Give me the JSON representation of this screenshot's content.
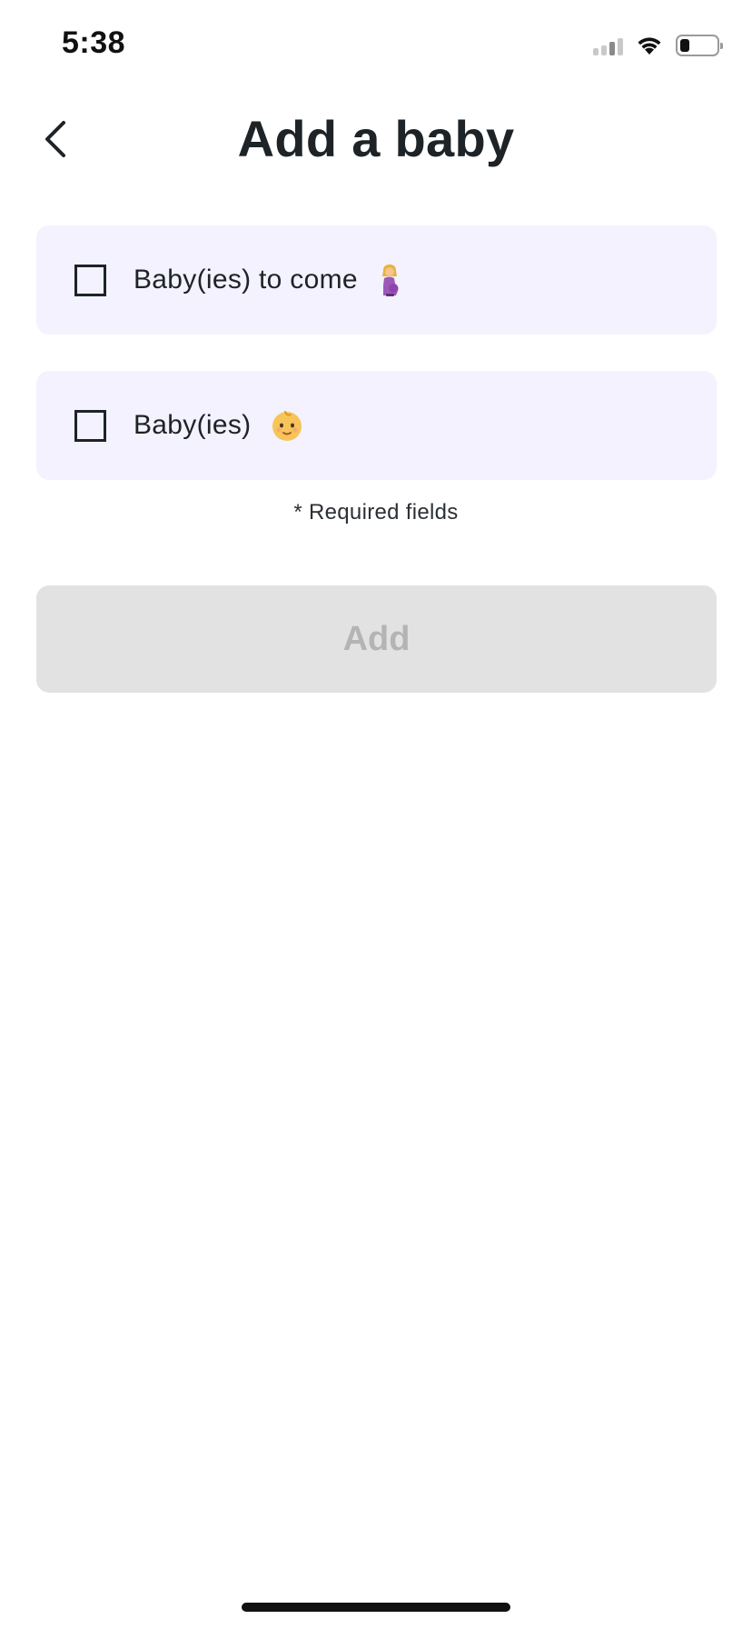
{
  "status_bar": {
    "time": "5:38",
    "icons": [
      "cellular-signal-icon",
      "wifi-icon",
      "battery-icon"
    ]
  },
  "header": {
    "back_icon": "chevron-left-icon",
    "title": "Add a baby"
  },
  "options": [
    {
      "label": "Baby(ies) to come",
      "emoji": "pregnant-woman-emoji",
      "checked": false
    },
    {
      "label": "Baby(ies)",
      "emoji": "baby-emoji",
      "checked": false
    }
  ],
  "required_note": "* Required fields",
  "add_button": {
    "label": "Add",
    "disabled": true
  },
  "colors": {
    "card_background": "#f3f2fe",
    "button_disabled_background": "#e2e2e2",
    "button_disabled_text": "#b4b4b4",
    "text_primary": "#1d2327"
  }
}
